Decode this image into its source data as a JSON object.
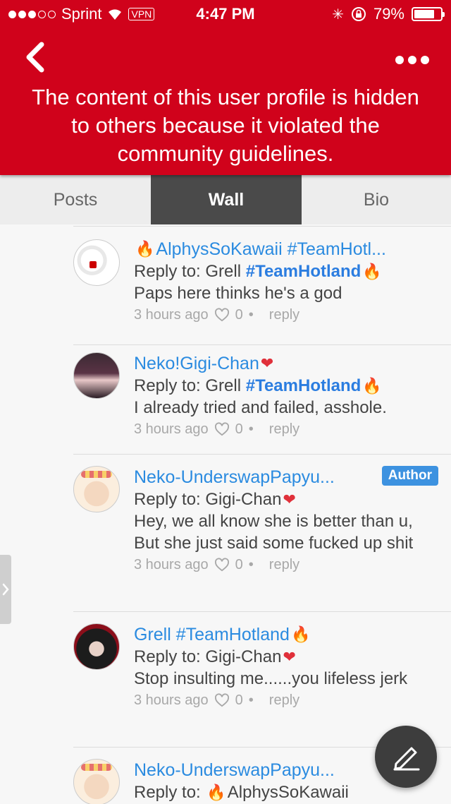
{
  "status_bar": {
    "carrier": "Sprint",
    "vpn": "VPN",
    "time": "4:47 PM",
    "battery": "79%",
    "battery_level": 0.79
  },
  "header": {
    "notice": "The content of this user profile is hidden to others because it violated the community guidelines.",
    "color": "#d0021b"
  },
  "tabs": [
    {
      "label": "Posts",
      "active": false
    },
    {
      "label": "Wall",
      "active": true
    },
    {
      "label": "Bio",
      "active": false
    }
  ],
  "comments": [
    {
      "author": "AlphysSoKawaii #TeamHotl...",
      "author_emoji_before": "fire",
      "reply_prefix": "Reply to: Grell ",
      "reply_tag": "#TeamHotland",
      "reply_emoji": "fire",
      "text": "Paps here thinks he's a god",
      "time": "3 hours ago",
      "likes": "0",
      "reply_label": "reply"
    },
    {
      "author": "Neko!Gigi-Chan",
      "author_emoji_after": "heart",
      "reply_prefix": "Reply to: Grell ",
      "reply_tag": "#TeamHotland",
      "reply_emoji": "fire",
      "text": "I already tried and failed, asshole.",
      "time": "3 hours ago",
      "likes": "0",
      "reply_label": "reply"
    },
    {
      "author": "Neko-UnderswapPapyu...",
      "badge": "Author",
      "reply_prefix": "Reply to: Gigi-Chan",
      "reply_emoji": "heart",
      "text": "Hey, we all know she is better than u, But she just said some fucked up shit",
      "time": "3 hours ago",
      "likes": "0",
      "reply_label": "reply"
    },
    {
      "author": "Grell #TeamHotland",
      "author_emoji_after": "fire",
      "reply_prefix": "Reply to: Gigi-Chan",
      "reply_emoji": "heart",
      "text": "Stop insulting me......you lifeless jerk",
      "time": "3 hours ago",
      "likes": "0",
      "reply_label": "reply"
    },
    {
      "author": "Neko-UnderswapPapyu...",
      "reply_prefix": "Reply to: ",
      "reply_emoji_before": "fire",
      "reply_name": "AlphysSoKawaii"
    }
  ],
  "icons": {
    "back": "chevron-left-icon",
    "more": "more-dots-icon",
    "like": "heart-outline-icon",
    "compose": "pencil-icon",
    "side": "chevron-right-icon"
  }
}
